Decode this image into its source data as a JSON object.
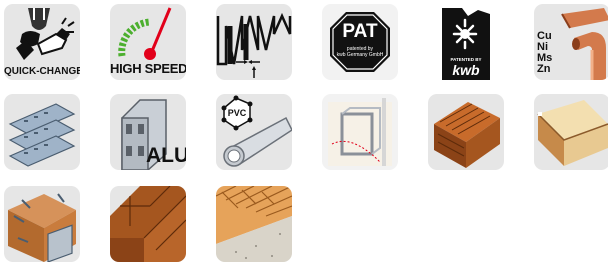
{
  "tiles": {
    "quick_change": {
      "label": "QUICK-CHANGE"
    },
    "high_speed": {
      "label": "HIGH SPEED"
    },
    "pat": {
      "label": "PAT",
      "sub1": "patented by",
      "sub2": "kwb Germany GmbH"
    },
    "patented_by": {
      "label": "PATENTED BY",
      "brand": "kwb"
    },
    "metals": {
      "lines": [
        "Cu",
        "Ni",
        "Ms",
        "Zn"
      ]
    },
    "alu": {
      "label": "ALU"
    },
    "pvc": {
      "label": "PVC"
    }
  },
  "colors": {
    "tile_bg": "#e6e6e6",
    "tile_bg_light": "#f2f2f2",
    "accent_red": "#e2001a",
    "speed_green": "#4caf2f",
    "copper": "#d37a4c",
    "wood": "#a5561f",
    "plate_blue": "#9fb3c8",
    "dark": "#111111"
  }
}
